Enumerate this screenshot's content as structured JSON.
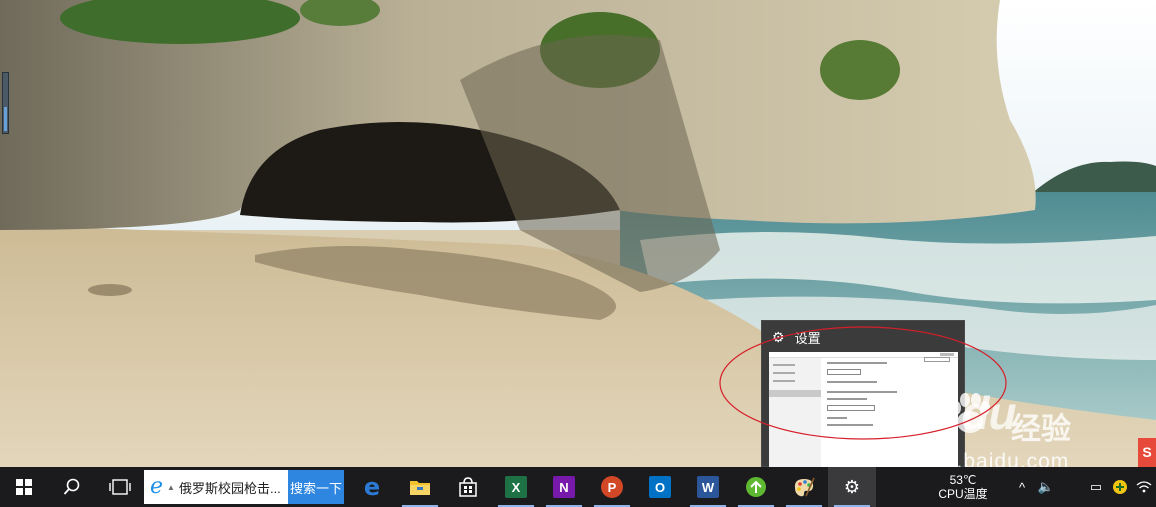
{
  "preview": {
    "title": "设置",
    "gear_icon": "gear-icon"
  },
  "taskbar": {
    "browser_tab_text": "俄罗斯校园枪击...",
    "search_button": "搜索一下",
    "apps": [
      {
        "name": "edge",
        "color": "#2b7bd6"
      },
      {
        "name": "file-explorer",
        "color": "#f2c12e"
      },
      {
        "name": "store",
        "color": "#ffffff"
      },
      {
        "name": "excel",
        "label": "X",
        "color": "#1e7145"
      },
      {
        "name": "onenote",
        "label": "N",
        "color": "#7719aa"
      },
      {
        "name": "powerpoint",
        "label": "P",
        "color": "#d24726"
      },
      {
        "name": "outlook",
        "label": "O",
        "color": "#0072c6"
      },
      {
        "name": "word",
        "label": "W",
        "color": "#2b579a"
      },
      {
        "name": "green-app",
        "color": "#5fb832"
      },
      {
        "name": "paint",
        "color": "#e0a040"
      },
      {
        "name": "settings",
        "color": "#ffffff"
      }
    ],
    "cpu_temp_value": "53℃",
    "cpu_temp_label": "CPU温度"
  },
  "watermark": {
    "logo": "Bai  du",
    "site_cn": "经验",
    "site_url": "jingyan.baidu.com",
    "badge": "S"
  },
  "colors": {
    "taskbar_bg": "#1b1b1e",
    "search_button_bg": "#2f86e0",
    "annotation_red": "#d61f2a"
  }
}
